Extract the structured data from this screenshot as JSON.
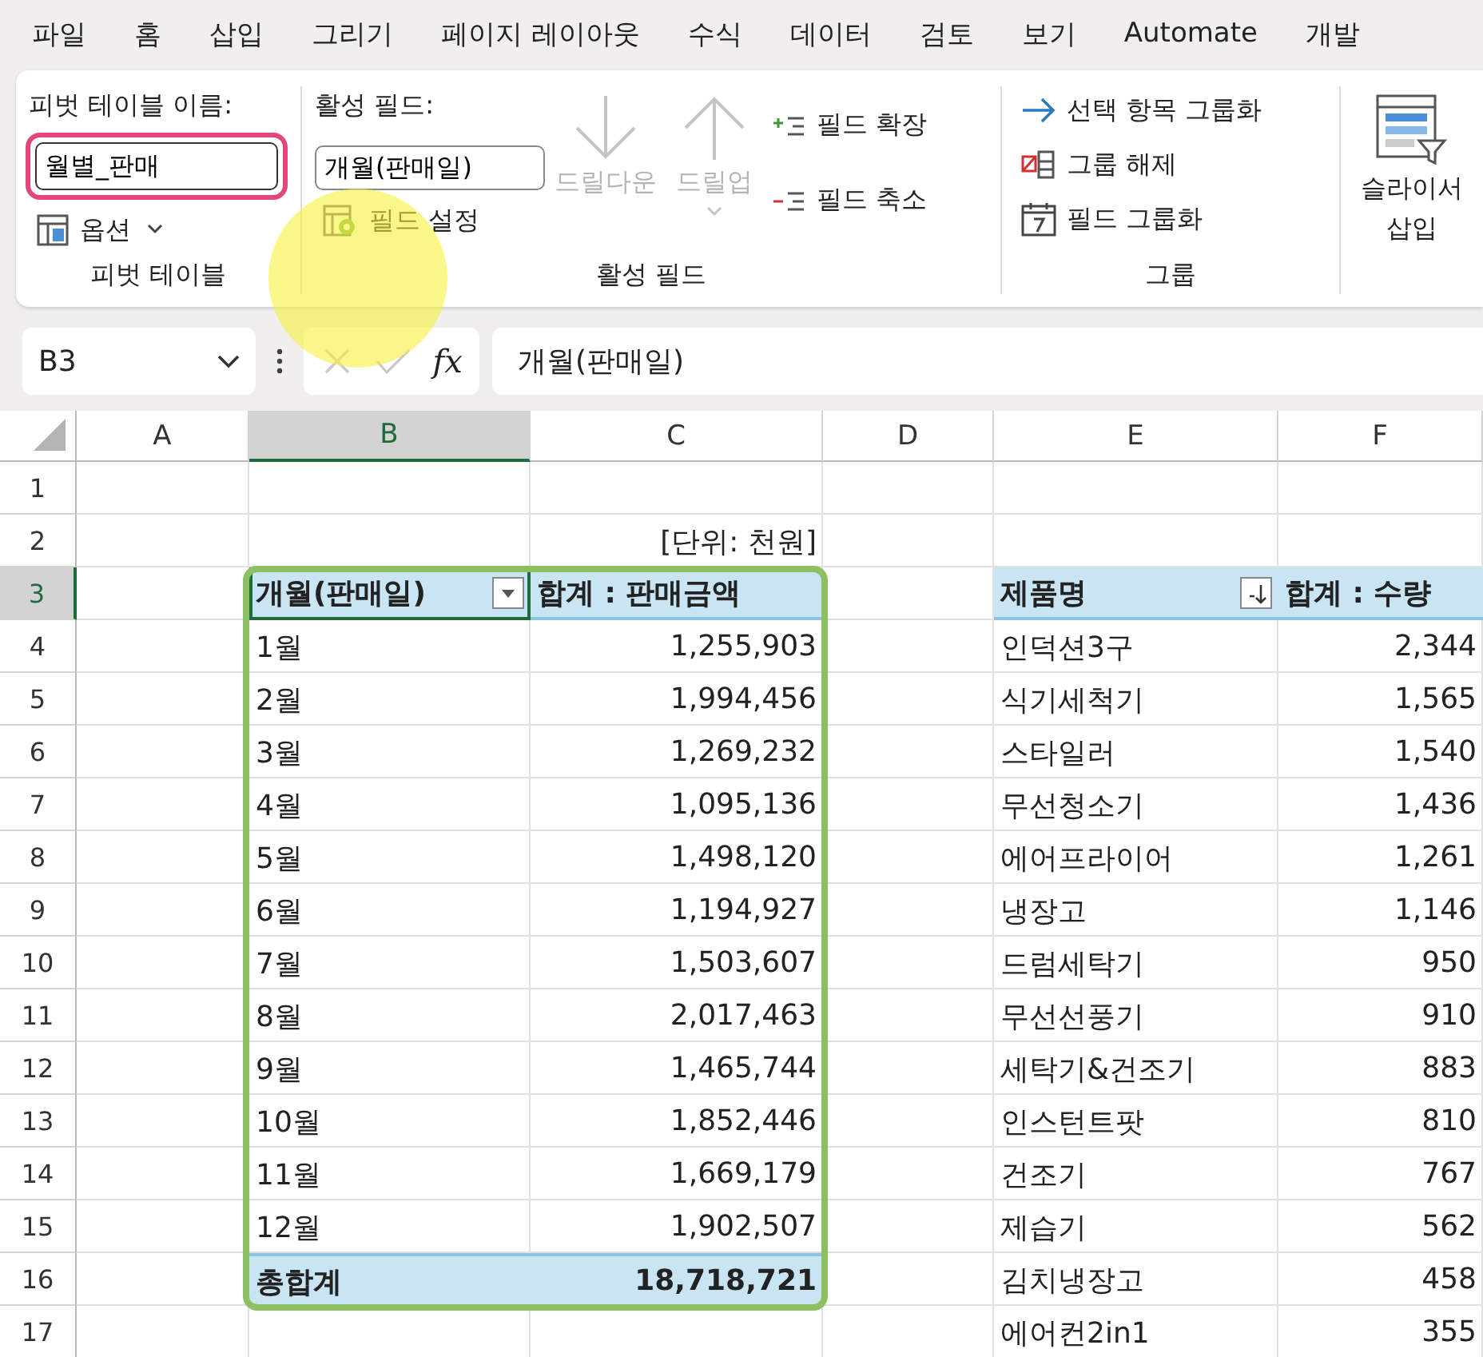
{
  "menu_tabs": [
    "파일",
    "홈",
    "삽입",
    "그리기",
    "페이지 레이아웃",
    "수식",
    "데이터",
    "검토",
    "보기",
    "Automate",
    "개발"
  ],
  "ribbon": {
    "pivot_table": {
      "name_label": "피벗 테이블 이름:",
      "name_value": "월별_판매",
      "name_highlighted": true,
      "options_button": "옵션",
      "group_label": "피벗 테이블"
    },
    "active_field": {
      "field_label": "활성 필드:",
      "field_value": "개월(판매일)",
      "field_settings": "필드 설정",
      "drill_down": {
        "label": "드릴다운",
        "disabled": true
      },
      "drill_up": {
        "label": "드릴업",
        "disabled": true
      },
      "expand": "필드 확장",
      "collapse": "필드 축소",
      "group_label": "활성 필드"
    },
    "group": {
      "items": [
        {
          "kind": "group-selection",
          "label": "선택 항목 그룹화"
        },
        {
          "kind": "ungroup",
          "label": "그룹 해제"
        },
        {
          "kind": "group-field",
          "label": "필드 그룹화"
        }
      ],
      "group_label": "그룹"
    },
    "slicer": {
      "label_lines": [
        "슬라이서",
        "삽입"
      ]
    }
  },
  "formula_bar": {
    "name_box": "B3",
    "cancel_disabled": true,
    "enter_disabled": true,
    "function_label": "fx",
    "formula": "개월(판매일)"
  },
  "cursor_highlight": {
    "visible": true
  },
  "sheet": {
    "columns": [
      {
        "label": "A",
        "selected": false
      },
      {
        "label": "B",
        "selected": true
      },
      {
        "label": "C",
        "selected": false
      },
      {
        "label": "D",
        "selected": false
      },
      {
        "label": "E",
        "selected": false
      },
      {
        "label": "F",
        "selected": false
      }
    ],
    "rows": [
      {
        "label": "1",
        "selected": false
      },
      {
        "label": "2",
        "selected": false
      },
      {
        "label": "3",
        "selected": true
      },
      {
        "label": "4",
        "selected": false
      },
      {
        "label": "5",
        "selected": false
      },
      {
        "label": "6",
        "selected": false
      },
      {
        "label": "7",
        "selected": false
      },
      {
        "label": "8",
        "selected": false
      },
      {
        "label": "9",
        "selected": false
      },
      {
        "label": "10",
        "selected": false
      },
      {
        "label": "11",
        "selected": false
      },
      {
        "label": "12",
        "selected": false
      },
      {
        "label": "13",
        "selected": false
      },
      {
        "label": "14",
        "selected": false
      },
      {
        "label": "15",
        "selected": false
      },
      {
        "label": "16",
        "selected": false
      },
      {
        "label": "17",
        "selected": false
      }
    ],
    "unit_note": "[단위: 천원]",
    "month_pivot": {
      "highlighted": true,
      "headers": [
        "개월(판매일)",
        "합계 : 판매금액"
      ],
      "rows": [
        [
          "1월",
          "1,255,903"
        ],
        [
          "2월",
          "1,994,456"
        ],
        [
          "3월",
          "1,269,232"
        ],
        [
          "4월",
          "1,095,136"
        ],
        [
          "5월",
          "1,498,120"
        ],
        [
          "6월",
          "1,194,927"
        ],
        [
          "7월",
          "1,503,607"
        ],
        [
          "8월",
          "2,017,463"
        ],
        [
          "9월",
          "1,465,744"
        ],
        [
          "10월",
          "1,852,446"
        ],
        [
          "11월",
          "1,669,179"
        ],
        [
          "12월",
          "1,902,507"
        ]
      ],
      "total": [
        "총합계",
        "18,718,721"
      ]
    },
    "product_pivot": {
      "headers": [
        "제품명",
        "합계 : 수량"
      ],
      "rows": [
        [
          "인덕션3구",
          "2,344"
        ],
        [
          "식기세척기",
          "1,565"
        ],
        [
          "스타일러",
          "1,540"
        ],
        [
          "무선청소기",
          "1,436"
        ],
        [
          "에어프라이어",
          "1,261"
        ],
        [
          "냉장고",
          "1,146"
        ],
        [
          "드럼세탁기",
          "950"
        ],
        [
          "무선선풍기",
          "910"
        ],
        [
          "세탁기&건조기",
          "883"
        ],
        [
          "인스턴트팟",
          "810"
        ],
        [
          "건조기",
          "767"
        ],
        [
          "제습기",
          "562"
        ],
        [
          "김치냉장고",
          "458"
        ],
        [
          "에어컨2in1",
          "355"
        ]
      ]
    }
  }
}
